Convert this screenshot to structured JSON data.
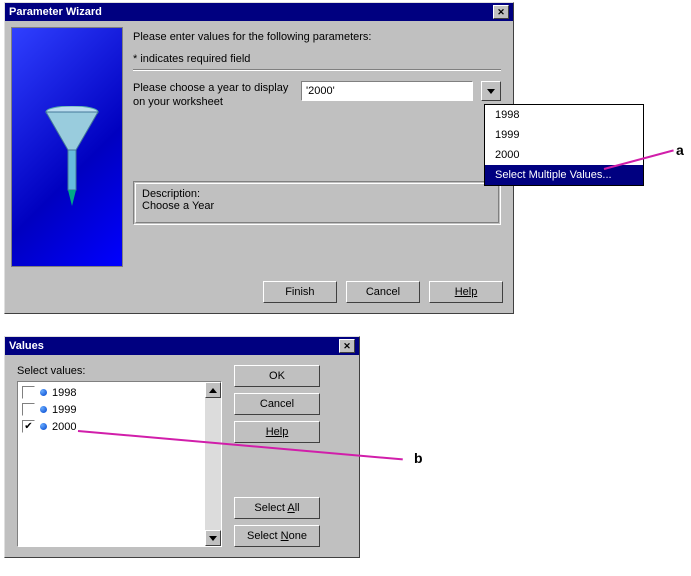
{
  "wizard": {
    "title": "Parameter Wizard",
    "prompt": "Please enter values for the following parameters:",
    "required_note": "* indicates required field",
    "param_label_line1": "Please choose a year to display",
    "param_label_line2": "on your worksheet",
    "param_value": "'2000'",
    "description_label": "Description:",
    "description_text": "Choose a Year",
    "buttons": {
      "finish": "Finish",
      "cancel": "Cancel",
      "help": "Help"
    }
  },
  "dropdown": {
    "items": [
      "1998",
      "1999",
      "2000"
    ],
    "multi_label": "Select Multiple Values..."
  },
  "values_dialog": {
    "title": "Values",
    "select_label": "Select values:",
    "rows": [
      {
        "checked": false,
        "label": "1998"
      },
      {
        "checked": false,
        "label": "1999"
      },
      {
        "checked": true,
        "label": "2000"
      }
    ],
    "buttons": {
      "ok": "OK",
      "cancel": "Cancel",
      "help": "Help",
      "select_all": "Select All",
      "select_none": "Select None"
    }
  },
  "annotations": {
    "a": "a",
    "b": "b"
  }
}
